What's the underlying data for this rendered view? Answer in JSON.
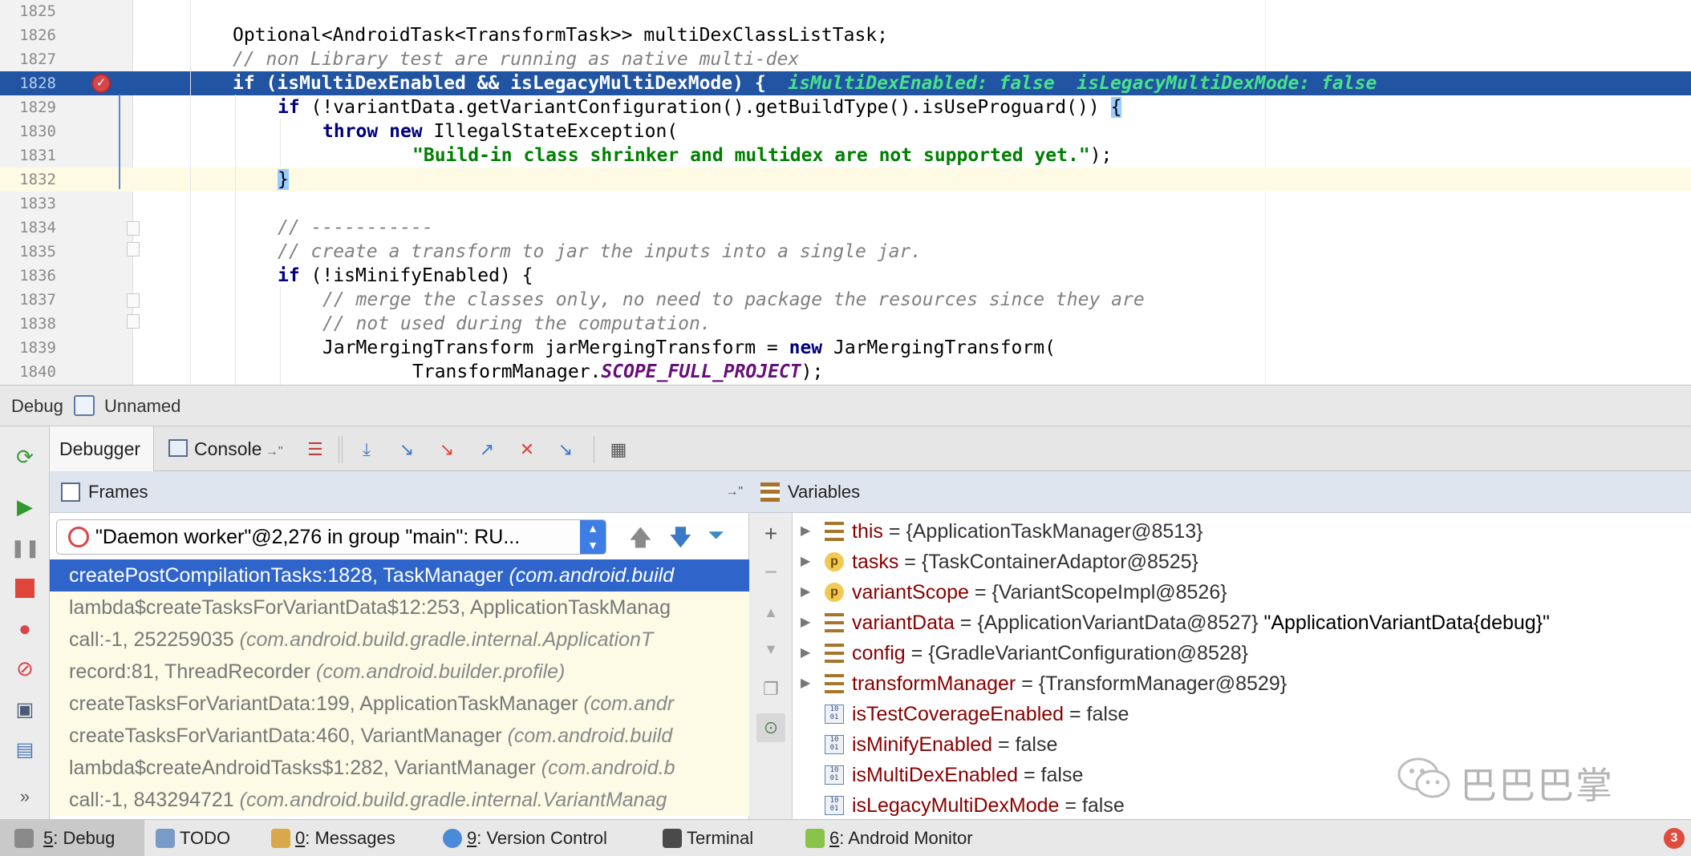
{
  "editor": {
    "lines": [
      {
        "num": "1825"
      },
      {
        "num": "1826"
      },
      {
        "num": "1827"
      },
      {
        "num": "1828"
      },
      {
        "num": "1829"
      },
      {
        "num": "1830"
      },
      {
        "num": "1831"
      },
      {
        "num": "1832"
      },
      {
        "num": "1833"
      },
      {
        "num": "1834"
      },
      {
        "num": "1835"
      },
      {
        "num": "1836"
      },
      {
        "num": "1837"
      },
      {
        "num": "1838"
      },
      {
        "num": "1839"
      },
      {
        "num": "1840"
      }
    ],
    "code": {
      "l1826": "Optional<AndroidTask<TransformTask>> multiDexClassListTask;",
      "l1827": "// non Library test are running as native multi-dex",
      "l1828_if": "if",
      "l1828_rest": " (isMultiDexEnabled && isLegacyMultiDexMode) {",
      "l1828_inline": "isMultiDexEnabled: false  isLegacyMultiDexMode: false",
      "l1829_if": "if",
      "l1829_rest": " (!variantData.getVariantConfiguration().getBuildType().isUseProguard()) ",
      "l1829_brace": "{",
      "l1830_throw": "throw",
      "l1830_new": "new",
      "l1830_rest": " IllegalStateException(",
      "l1831_str": "\"Build-in class shrinker and multidex are not supported yet.\"",
      "l1831_rest": ");",
      "l1832_brace": "}",
      "l1834": "// -----------",
      "l1835": "// create a transform to jar the inputs into a single jar.",
      "l1836_if": "if",
      "l1836_rest": " (!isMinifyEnabled) {",
      "l1837": "// merge the classes only, no need to package the resources since they are",
      "l1838": "// not used during the computation.",
      "l1839_a": "JarMergingTransform jarMergingTransform = ",
      "l1839_new": "new",
      "l1839_b": " JarMergingTransform(",
      "l1840_a": "TransformManager.",
      "l1840_const": "SCOPE_FULL_PROJECT",
      "l1840_b": ");"
    }
  },
  "debug_bar": {
    "label": "Debug",
    "config": "Unnamed"
  },
  "tabs": {
    "debugger": "Debugger",
    "console": "Console"
  },
  "frames": {
    "title": "Frames",
    "thread": "\"Daemon worker\"@2,276 in group \"main\": RU...",
    "items": [
      {
        "method": "createPostCompilationTasks:1828, TaskManager ",
        "pkg": "(com.android.build"
      },
      {
        "method": "lambda$createTasksForVariantData$12:253, ApplicationTaskManag",
        "pkg": ""
      },
      {
        "method": "call:-1, 252259035 ",
        "pkg": "(com.android.build.gradle.internal.ApplicationT"
      },
      {
        "method": "record:81, ThreadRecorder ",
        "pkg": "(com.android.builder.profile)"
      },
      {
        "method": "createTasksForVariantData:199, ApplicationTaskManager ",
        "pkg": "(com.andr"
      },
      {
        "method": "createTasksForVariantData:460, VariantManager ",
        "pkg": "(com.android.build"
      },
      {
        "method": "lambda$createAndroidTasks$1:282, VariantManager ",
        "pkg": "(com.android.b"
      },
      {
        "method": "call:-1, 843294721 ",
        "pkg": "(com.android.build.gradle.internal.VariantManag"
      }
    ]
  },
  "variables": {
    "title": "Variables",
    "items": [
      {
        "name": "this",
        "value": " = {ApplicationTaskManager@8513}",
        "extra": "",
        "icon": "field"
      },
      {
        "name": "tasks",
        "value": " = {TaskContainerAdaptor@8525}",
        "extra": "",
        "icon": "p"
      },
      {
        "name": "variantScope",
        "value": " = {VariantScopeImpl@8526}",
        "extra": "",
        "icon": "p"
      },
      {
        "name": "variantData",
        "value": " = {ApplicationVariantData@8527} ",
        "extra": "\"ApplicationVariantData{debug}\"",
        "icon": "field"
      },
      {
        "name": "config",
        "value": " = {GradleVariantConfiguration@8528}",
        "extra": "",
        "icon": "field"
      },
      {
        "name": "transformManager",
        "value": " = {TransformManager@8529}",
        "extra": "",
        "icon": "field"
      },
      {
        "name": "isTestCoverageEnabled",
        "value": " = false",
        "extra": "",
        "icon": "prim"
      },
      {
        "name": "isMinifyEnabled",
        "value": " = false",
        "extra": "",
        "icon": "prim"
      },
      {
        "name": "isMultiDexEnabled",
        "value": " = false",
        "extra": "",
        "icon": "prim"
      },
      {
        "name": "isLegacyMultiDexMode",
        "value": " = false",
        "extra": "",
        "icon": "prim"
      }
    ]
  },
  "watermark": {
    "text": "巴巴巴掌"
  },
  "statusbar": {
    "items": [
      {
        "num": "5",
        "label": ": Debug"
      },
      {
        "num": "",
        "label": "TODO"
      },
      {
        "num": "0",
        "label": ": Messages"
      },
      {
        "num": "9",
        "label": ": Version Control"
      },
      {
        "num": "",
        "label": "Terminal"
      },
      {
        "num": "6",
        "label": ": Android Monitor"
      }
    ],
    "notification_count": "3"
  },
  "colors": {
    "exec_line": "#2154a3",
    "selected_frame": "#2f65ca",
    "library_frame_bg": "#fdfbe6",
    "variable_name": "#880000",
    "keyword": "#000080",
    "string": "#008000"
  }
}
